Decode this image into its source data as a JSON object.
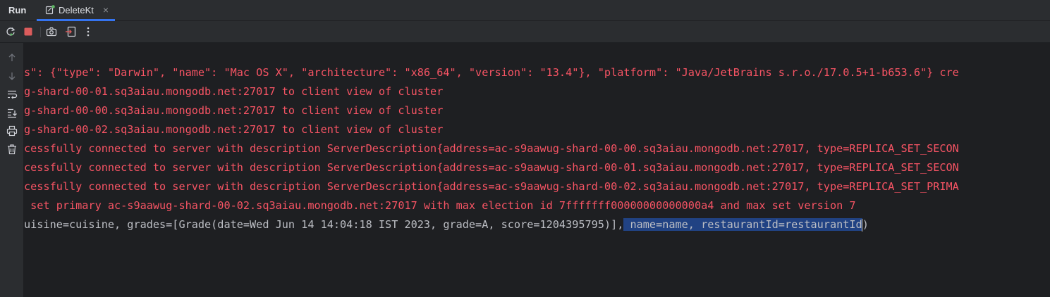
{
  "run_panel": {
    "title": "Run",
    "tab": {
      "label": "DeleteKt",
      "close": "×"
    }
  },
  "toolbar": {
    "buttons": [
      "rerun-icon",
      "stop-icon",
      "screenshot-icon",
      "exit-icon",
      "more-icon"
    ]
  },
  "sidebar": {
    "buttons": [
      "scroll-up-icon",
      "scroll-down-icon",
      "soft-wrap-icon",
      "scroll-to-end-icon",
      "print-icon",
      "clear-icon"
    ]
  },
  "console": {
    "lines": [
      "s\": {\"type\": \"Darwin\", \"name\": \"Mac OS X\", \"architecture\": \"x86_64\", \"version\": \"13.4\"}, \"platform\": \"Java/JetBrains s.r.o./17.0.5+1-b653.6\"} cre",
      "g-shard-00-01.sq3aiau.mongodb.net:27017 to client view of cluster",
      "g-shard-00-00.sq3aiau.mongodb.net:27017 to client view of cluster",
      "g-shard-00-02.sq3aiau.mongodb.net:27017 to client view of cluster",
      "cessfully connected to server with description ServerDescription{address=ac-s9aawug-shard-00-00.sq3aiau.mongodb.net:27017, type=REPLICA_SET_SECON",
      "cessfully connected to server with description ServerDescription{address=ac-s9aawug-shard-00-01.sq3aiau.mongodb.net:27017, type=REPLICA_SET_SECON",
      "cessfully connected to server with description ServerDescription{address=ac-s9aawug-shard-00-02.sq3aiau.mongodb.net:27017, type=REPLICA_SET_PRIMA",
      " set primary ac-s9aawug-shard-00-02.sq3aiau.mongodb.net:27017 with max election id 7fffffff00000000000000a4 and max set version 7"
    ],
    "output_line": {
      "before_selection": "uisine=cuisine, grades=[Grade(date=Wed Jun 14 14:04:18 IST 2023, grade=A, score=1204395795)],",
      "selection": " name=name, restaurantId=restaurantId",
      "after_selection": ")"
    }
  },
  "colors": {
    "stderr_text": "#f75464",
    "stdout_text": "#bcbec4",
    "selection": "#214283",
    "accent": "#3574f0",
    "panel_bg": "#2b2d30",
    "console_bg": "#1e1f22"
  }
}
